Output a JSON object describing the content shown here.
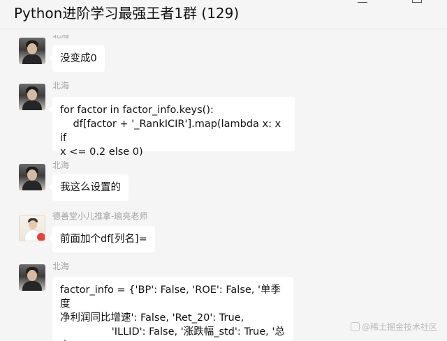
{
  "window": {
    "title": "Python进阶学习最强王者1群 (129)"
  },
  "messages": [
    {
      "sender": "北海",
      "avatar": "person-avatar",
      "text": "没变成0"
    },
    {
      "sender": "北海",
      "avatar": "person-avatar",
      "text": "for factor in factor_info.keys():\n    df[factor + '_RankICIR'].map(lambda x: x if\nx <= 0.2 else 0)"
    },
    {
      "sender": "北海",
      "avatar": "person-avatar",
      "text": "我这么设置的"
    },
    {
      "sender": "德善堂小儿推拿-瑜亮老师",
      "avatar": "teacher-avatar",
      "text": "前面加个df[列名]="
    },
    {
      "sender": "北海",
      "avatar": "person-avatar",
      "text": "factor_info = {'BP': False, 'ROE': False, '单季度\n净利润同比增速': False, 'Ret_20': True,\n                'ILLID': False, '涨跌幅_std': True, '总市\n值': True}"
    }
  ],
  "watermark": {
    "text": "@稀土掘金技术社区"
  }
}
